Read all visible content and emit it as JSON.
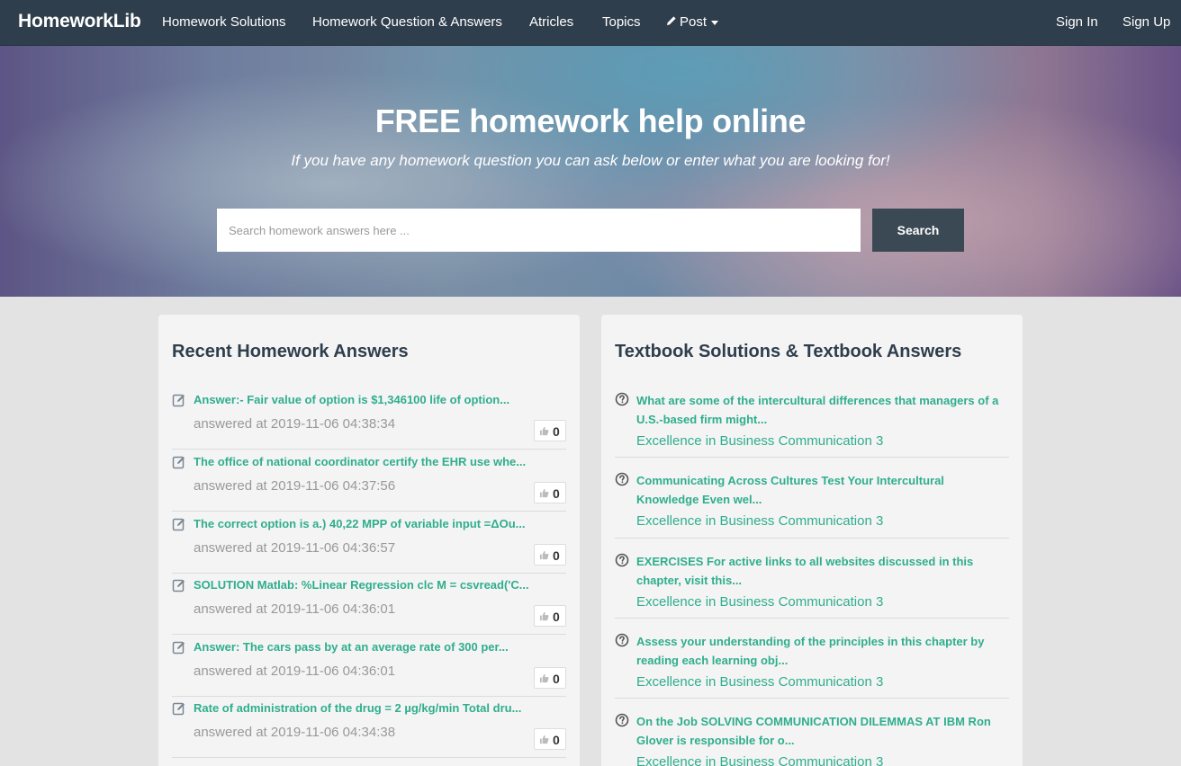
{
  "navbar": {
    "brand": "HomeworkLib",
    "items": [
      "Homework Solutions",
      "Homework Question & Answers",
      "Atricles",
      "Topics"
    ],
    "post_label": "Post",
    "signin": "Sign In",
    "signup": "Sign Up",
    "bg_color": "#2f3e4c"
  },
  "hero": {
    "title": "FREE homework help online",
    "subtitle": "If you have any homework question you can ask below or enter what you are looking for!",
    "search_placeholder": "Search homework answers here ...",
    "search_button": "Search"
  },
  "recent": {
    "title": "Recent Homework Answers",
    "items": [
      {
        "text": "Answer:- Fair value of option is $1,346100 life of option...",
        "time": "answered at 2019-11-06 04:38:34",
        "votes": "0"
      },
      {
        "text": "The office of national coordinator certify the EHR use whe...",
        "time": "answered at 2019-11-06 04:37:56",
        "votes": "0"
      },
      {
        "text": "The correct option is a.) 40,22 MPP of variable input =ΔOu...",
        "time": "answered at 2019-11-06 04:36:57",
        "votes": "0"
      },
      {
        "text": "SOLUTION Matlab: %Linear Regression clc M = csvread('C...",
        "time": "answered at 2019-11-06 04:36:01",
        "votes": "0"
      },
      {
        "text": "Answer: The cars pass by at an average rate of 300 per...",
        "time": "answered at 2019-11-06 04:36:01",
        "votes": "0"
      },
      {
        "text": "Rate of administration of the drug = 2 µg/kg/min Total dru...",
        "time": "answered at 2019-11-06 04:34:38",
        "votes": "0"
      }
    ]
  },
  "textbook": {
    "title": "Textbook Solutions & Textbook Answers",
    "items": [
      {
        "question": "What are some of the intercultural differences that managers of a U.S.-based firm might...",
        "book": "Excellence in Business Communication 3"
      },
      {
        "question": "Communicating Across Cultures Test Your Intercultural Knowledge Even wel...",
        "book": "Excellence in Business Communication 3"
      },
      {
        "question": "EXERCISES For active links to all websites discussed in this chapter, visit this...",
        "book": "Excellence in Business Communication 3"
      },
      {
        "question": "Assess your understanding of the principles in this chapter by reading each learning obj...",
        "book": "Excellence in Business Communication 3"
      },
      {
        "question": "On the Job SOLVING COMMUNICATION DILEMMAS AT IBM Ron Glover is responsible for o...",
        "book": "Excellence in Business Communication 3"
      }
    ]
  },
  "colors": {
    "accent_green": "#2fae8d",
    "heading_dark": "#2f3e4c",
    "muted_gray": "#999999"
  }
}
